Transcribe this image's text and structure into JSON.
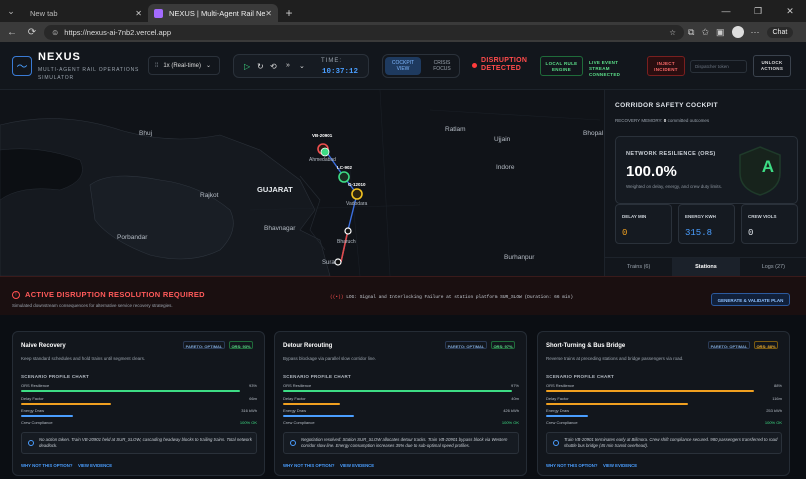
{
  "browser": {
    "tabs": [
      {
        "label": "New tab"
      },
      {
        "label": "NEXUS | Multi-Agent Rail Network"
      }
    ],
    "url": "https://nexus-ai-7nb2.vercel.app",
    "chat_label": "Chat"
  },
  "header": {
    "brand": "NEXUS",
    "subtitle": "MULTI-AGENT RAIL OPERATIONS SIMULATOR",
    "speed": "1x (Real-time)",
    "time_label": "TIME:",
    "time_value": "10:37:12",
    "view_active": "COCKPIT VIEW",
    "view_other": "CRISIS FOCUS",
    "disruption": "DISRUPTION DETECTED",
    "engine": "LOCAL RULE ENGINE",
    "stream": "LIVE EVENT STREAM CONNECTED",
    "inject": "INJECT INCIDENT",
    "token_placeholder": "Dispatcher token",
    "unlock": "UNLOCK ACTIONS"
  },
  "map": {
    "places": [
      "Bhuj",
      "Rajkot",
      "GUJARAT",
      "Porbandar",
      "Bhavnagar",
      "Ratlam",
      "Ujjain",
      "Indore",
      "Bhopal",
      "Vadodara",
      "Ahmedabad",
      "Bharuch",
      "Surat",
      "Burhanpur"
    ],
    "trains": [
      "VB-20901",
      "LC-902",
      "G-12010"
    ]
  },
  "sidebar": {
    "title": "CORRIDOR SAFETY COCKPIT",
    "memory_prefix": "RECOVERY MEMORY:",
    "memory_count": "0",
    "memory_suffix": "committed outcomes",
    "ors_label": "NETWORK RESILIENCE (ORS)",
    "ors_value": "100.0%",
    "ors_caption": "Weighted on delay, energy, and crew duty limits.",
    "grade": "A",
    "kpis": [
      {
        "label": "DELAY MIN",
        "value": "0",
        "color": "#f0a020"
      },
      {
        "label": "ENERGY KWH",
        "value": "315.8",
        "color": "#4a9eff"
      },
      {
        "label": "CREW VIOLS",
        "value": "0",
        "color": "#dfe4ea"
      }
    ],
    "tabs": [
      "Trains (6)",
      "Stations",
      "Logs (27)"
    ]
  },
  "disruption": {
    "title": "ACTIVE DISRUPTION RESOLUTION REQUIRED",
    "subtitle": "Simulated downstream consequences for alternative service recovery strategies.",
    "log": "LOG: Signal and Interlocking Failure at station platform SUR_SLOW (Duration: 66 min)",
    "generate": "GENERATE & VALIDATE PLAN"
  },
  "strategies": [
    {
      "name": "Naive Recovery",
      "desc": "Keep standard schedules and hold trains until segment clears.",
      "pareto": "PARETO: OPTIMAL",
      "quality": "ORS: 93%",
      "chart_label": "SCENARIO PROFILE CHART",
      "metrics": [
        {
          "label": "ORS Resilience",
          "value": "93%",
          "fraction": 0.93,
          "color": "#3ddc84"
        },
        {
          "label": "Delay Factor",
          "value": "66m",
          "fraction": 0.38,
          "color": "#f0a020"
        },
        {
          "label": "Energy Draw",
          "value": "316 kWh",
          "fraction": 0.22,
          "color": "#4a9eff"
        },
        {
          "label": "Crew Compliance",
          "value": "100% OK",
          "fraction": 0.0,
          "color": "#3ddc84"
        }
      ],
      "note": "No action taken. Train VB-20901 held at SUR_SLOW, cascading headway blocks to trailing trains. Total network deadlock.",
      "why": "WHY NOT THIS OPTION?",
      "evidence": "VIEW EVIDENCE"
    },
    {
      "name": "Detour Rerouting",
      "desc": "Bypass blockage via parallel slow corridor line.",
      "pareto": "PARETO: OPTIMAL",
      "quality": "ORS: 97%",
      "chart_label": "SCENARIO PROFILE CHART",
      "metrics": [
        {
          "label": "ORS Resilience",
          "value": "97%",
          "fraction": 0.97,
          "color": "#3ddc84"
        },
        {
          "label": "Delay Factor",
          "value": "40m",
          "fraction": 0.24,
          "color": "#f0a020"
        },
        {
          "label": "Energy Draw",
          "value": "426 kWh",
          "fraction": 0.3,
          "color": "#4a9eff"
        },
        {
          "label": "Crew Compliance",
          "value": "100% OK",
          "fraction": 0.0,
          "color": "#3ddc84"
        }
      ],
      "note": "Negotiation resolved: Station SUR_SLOW allocates detour tracks. Train VB-20901 bypass block via Western corridor slow line. Energy consumption increases 35% due to sub-optimal speed profiles.",
      "why": "WHY NOT THIS OPTION?",
      "evidence": "VIEW EVIDENCE"
    },
    {
      "name": "Short-Turning & Bus Bridge",
      "desc": "Reverse trains at preceding stations and bridge passengers via road.",
      "pareto": "PARETO: OPTIMAL",
      "quality": "ORS: 88%",
      "chart_label": "SCENARIO PROFILE CHART",
      "metrics": [
        {
          "label": "ORS Resilience",
          "value": "88%",
          "fraction": 0.88,
          "color": "#f0a020"
        },
        {
          "label": "Delay Factor",
          "value": "116m",
          "fraction": 0.6,
          "color": "#f0a020"
        },
        {
          "label": "Energy Draw",
          "value": "253 kWh",
          "fraction": 0.18,
          "color": "#4a9eff"
        },
        {
          "label": "Crew Compliance",
          "value": "100% OK",
          "fraction": 0.0,
          "color": "#3ddc84"
        }
      ],
      "note": "Train VB-20901 terminates early at Bilimora. Crew shift compliance secured. 980 passengers transferred to road shuttle bus bridge (45 min transit overhead).",
      "why": "WHY NOT THIS OPTION?",
      "evidence": "VIEW EVIDENCE"
    }
  ]
}
